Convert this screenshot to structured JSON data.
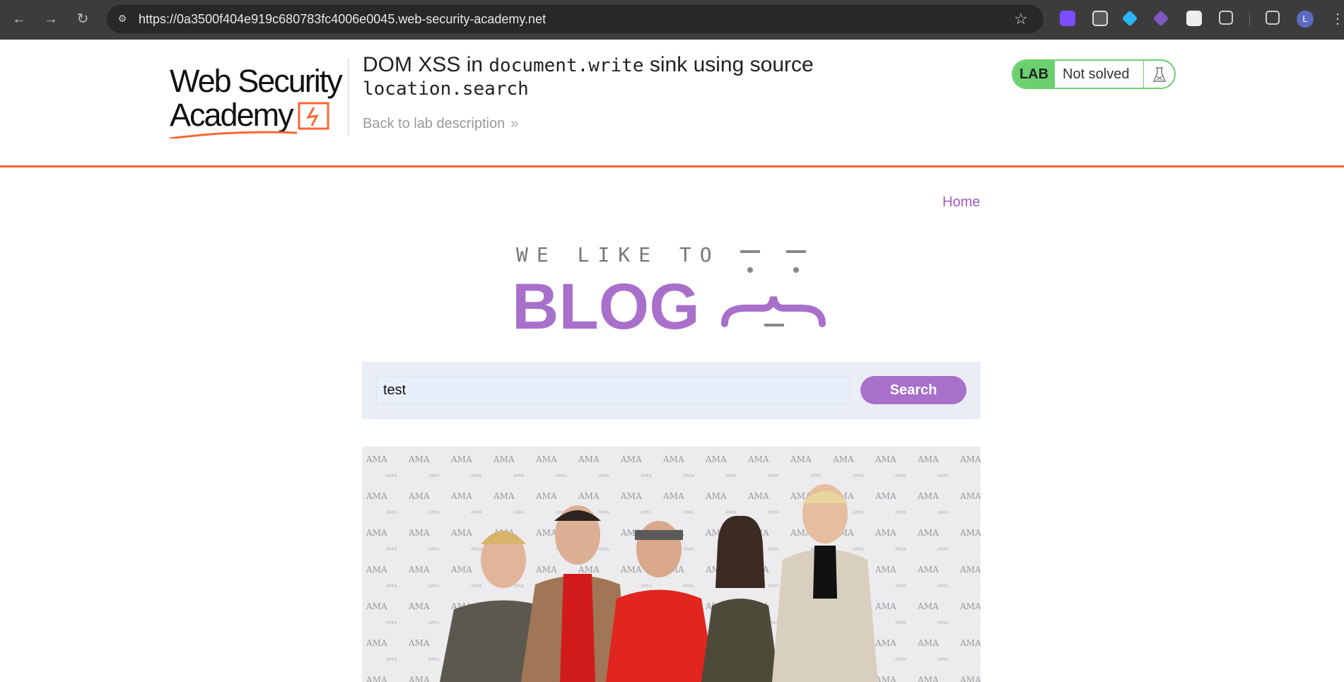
{
  "browser": {
    "url": "https://0a3500f404e919c680783fc4006e0045.web-security-academy.net",
    "profile_initial": "L",
    "icons": {
      "back": "arrow-left-icon",
      "forward": "arrow-right-icon",
      "reload": "reload-icon",
      "site_info": "tune-icon",
      "bookmark": "star-icon",
      "extensions": "puzzle-icon",
      "side_panel": "side-panel-icon",
      "menu": "kebab-icon"
    }
  },
  "lab": {
    "title_part1": "DOM XSS in",
    "title_code1": "document.write",
    "title_part2": "sink using source",
    "title_code2": "location.search",
    "back_link": "Back to lab description",
    "badge": "LAB",
    "status": "Not solved",
    "colors": {
      "accent": "#ff6633",
      "status_green": "#6bd06e"
    }
  },
  "logo": {
    "line1": "Web Security",
    "line2": "Academy"
  },
  "blog": {
    "home_link": "Home",
    "tagline": "WE LIKE TO",
    "name": "BLOG",
    "search_value": "test",
    "search_button": "Search",
    "colors": {
      "purple": "#a970cb",
      "search_bg": "#e8eef3"
    }
  }
}
